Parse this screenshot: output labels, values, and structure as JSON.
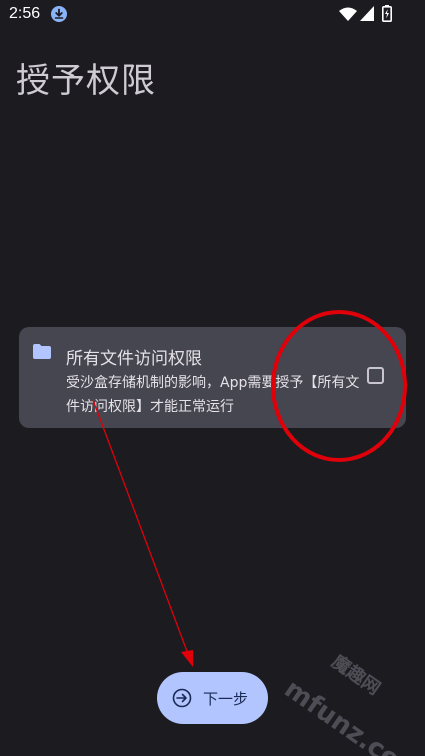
{
  "status_bar": {
    "time": "2:56",
    "icons": [
      "download-icon",
      "wifi-icon",
      "signal-icon",
      "battery-icon"
    ]
  },
  "page": {
    "title": "授予权限"
  },
  "permission": {
    "icon": "folder-icon",
    "title": "所有文件访问权限",
    "description": "受沙盒存储机制的影响，App需要授予【所有文件访问权限】才能正常运行",
    "checked": false
  },
  "next_button": {
    "icon": "arrow-circle-right-icon",
    "label": "下一步"
  },
  "annotation": {
    "color": "#e0000a",
    "shapes": [
      "circle-around-checkbox",
      "arrow-to-next-button"
    ]
  },
  "watermark": {
    "brand": "魔趣网",
    "url": "mfunz.com"
  },
  "colors": {
    "background": "#1c1b20",
    "card": "#45464f",
    "button": "#b3c5ff"
  }
}
